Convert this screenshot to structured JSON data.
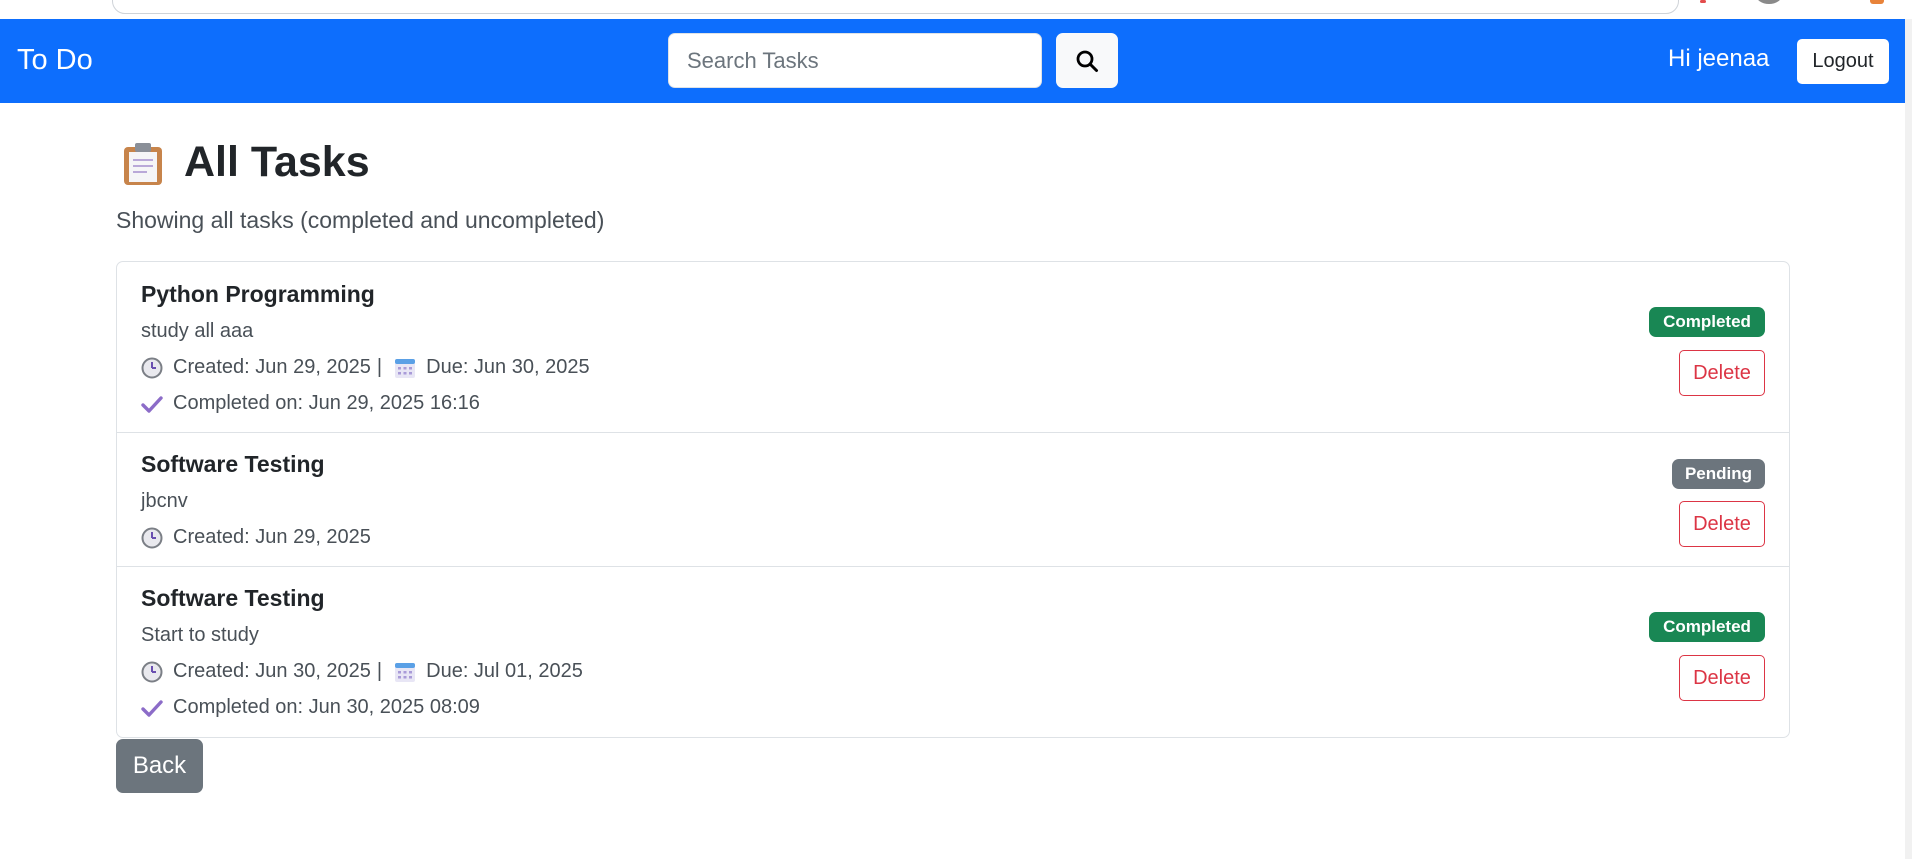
{
  "navbar": {
    "brand": "To Do",
    "search_placeholder": "Search Tasks",
    "search_icon": "search-icon",
    "greeting": "Hi jeenaa",
    "logout_label": "Logout",
    "background_color": "#0d6efd"
  },
  "page": {
    "title_icon": "clipboard-icon",
    "title": "All Tasks",
    "subtitle": "Showing all tasks (completed and uncompleted)"
  },
  "tasks": [
    {
      "title": "Python Programming",
      "description": "study all aaa",
      "created": "Created: Jun 29, 2025",
      "separator": "|",
      "due": "Due: Jun 30, 2025",
      "completed_on": "Completed on: Jun 29, 2025 16:16",
      "status": "Completed",
      "delete_label": "Delete"
    },
    {
      "title": "Software Testing",
      "description": "jbcnv",
      "created": "Created: Jun 29, 2025",
      "status": "Pending",
      "delete_label": "Delete"
    },
    {
      "title": "Software Testing",
      "description": "Start to study",
      "created": "Created: Jun 30, 2025",
      "separator": "|",
      "due": "Due: Jul 01, 2025",
      "completed_on": "Completed on: Jun 30, 2025 08:09",
      "status": "Completed",
      "delete_label": "Delete"
    }
  ],
  "status_colors": {
    "Completed": "#198754",
    "Pending": "#6c757d"
  },
  "back_label": "Back"
}
